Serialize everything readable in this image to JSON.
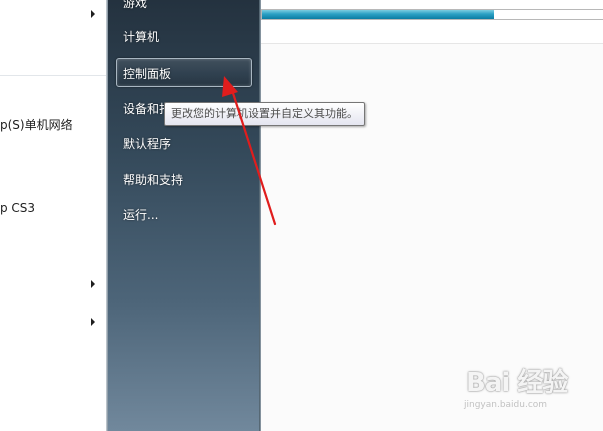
{
  "left_list": {
    "items": [
      {
        "label": "p(S)单机网络"
      },
      {
        "label": "p CS3"
      }
    ]
  },
  "start_menu": {
    "items": [
      {
        "label": "游戏"
      },
      {
        "label": "计算机"
      },
      {
        "label": "控制面板"
      },
      {
        "label": "设备和打"
      },
      {
        "label": "默认程序"
      },
      {
        "label": "帮助和支持"
      },
      {
        "label": "运行..."
      }
    ]
  },
  "tooltip": {
    "text": "更改您的计算机设置并自定义其功能。"
  },
  "background_window": {
    "progress_fraction": 0.68,
    "progress_color": "#0a7ca3"
  },
  "annotation": {
    "color": "#e01d1d"
  },
  "watermark": {
    "brand": "Bai 经验",
    "url": "jingyan.baidu.com"
  }
}
